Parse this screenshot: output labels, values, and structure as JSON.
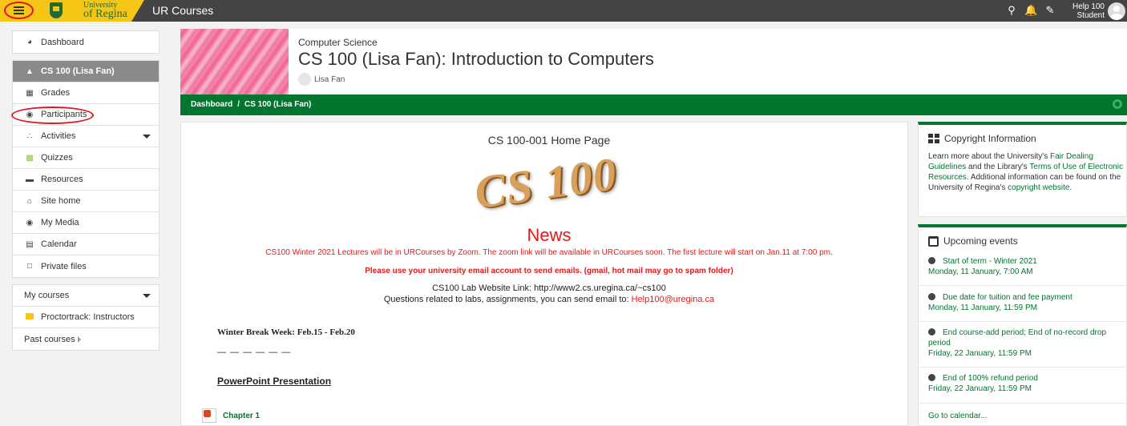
{
  "topbar": {
    "site_name": "UR Courses",
    "logo_line1": "University",
    "logo_line2": "of Regina",
    "user_name": "Help 100",
    "user_role": "Student"
  },
  "nav": {
    "dashboard": "Dashboard",
    "course": "CS 100 (Lisa Fan)",
    "grades": "Grades",
    "participants": "Participants",
    "activities": "Activities",
    "quizzes": "Quizzes",
    "resources": "Resources",
    "site_home": "Site home",
    "my_media": "My Media",
    "calendar": "Calendar",
    "private_files": "Private files",
    "my_courses": "My courses",
    "proctortrack": "Proctortrack: Instructors",
    "past_courses": "Past courses"
  },
  "header": {
    "category": "Computer Science",
    "title": "CS 100 (Lisa Fan): Introduction to Computers",
    "teacher": "Lisa Fan"
  },
  "breadcrumb": [
    "Dashboard",
    "CS 100 (Lisa Fan)"
  ],
  "main": {
    "home_title": "CS 100-001 Home Page",
    "logo_text": "CS 100",
    "news_title": "News",
    "news_line1": "CS100 Winter 2021 Lectures will be in URCourses by Zoom. The zoom link will be available in URCourses soon. The first lecture will start on Jan.11 at 7:00 pm.",
    "news_line2": "Please use your university email account to send emails. (gmail, hot mail may go to spam folder)",
    "lab_line": "CS100 Lab Website Link: http://www2.cs.uregina.ca/~cs100",
    "questions_prefix": "Questions related to labs, assignments, you can send email to: ",
    "questions_email": "Help100@uregina.ca",
    "winter_break": "Winter Break Week: Feb.15 - Feb.20",
    "dashes": "— — — — — —",
    "ppt_heading": "PowerPoint Presentation",
    "chapter1": "Chapter 1"
  },
  "copyright": {
    "title": "Copyright Information",
    "t1": "Learn more about the University's ",
    "link1": "Fair Dealing Guidelines",
    "t2": " and the Library's ",
    "link2": "Terms of Use of Electronic Resources",
    "t3": ". Additional information can be found on the University of Regina's ",
    "link3": "copyright website",
    "t4": "."
  },
  "events": {
    "title": "Upcoming events",
    "items": [
      {
        "name": "Start of term - Winter 2021",
        "date": "Monday, 11 January, 7:00 AM"
      },
      {
        "name": "Due date for tuition and fee payment",
        "date": "Monday, 11 January, 11:59 PM"
      },
      {
        "name": "End course-add period; End of no-record drop period",
        "date": "Friday, 22 January, 11:59 PM"
      },
      {
        "name": "End of 100% refund period",
        "date": "Friday, 22 January, 11:59 PM"
      }
    ],
    "goto": "Go to calendar..."
  }
}
